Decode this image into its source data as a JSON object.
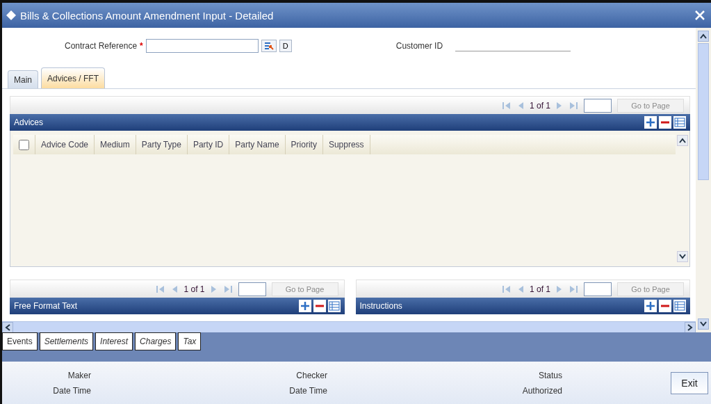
{
  "window": {
    "title": "Bills & Collections Amount Amendment Input - Detailed"
  },
  "header": {
    "contract_reference_label": "Contract Reference",
    "required_mark": "*",
    "default_button": "D",
    "customer_id_label": "Customer ID"
  },
  "tabs": [
    {
      "label": "Main",
      "selected": false
    },
    {
      "label": "Advices / FFT",
      "selected": true
    }
  ],
  "advices": {
    "title": "Advices",
    "pager": {
      "page_text": "1 of 1",
      "go_button": "Go to Page",
      "go_disabled": true
    },
    "select_all_checked": false,
    "columns": [
      "Advice Code",
      "Medium",
      "Party Type",
      "Party ID",
      "Party Name",
      "Priority",
      "Suppress"
    ]
  },
  "sub_panels": [
    {
      "title": "Free Format Text",
      "pager": {
        "page_text": "1 of 1",
        "go_button": "Go to Page",
        "go_disabled": true
      }
    },
    {
      "title": "Instructions",
      "pager": {
        "page_text": "1 of 1",
        "go_button": "Go to Page",
        "go_disabled": true
      }
    }
  ],
  "bottom_tabs": [
    {
      "label": "Events",
      "kind": "normal"
    },
    {
      "label": "Settlements",
      "kind": "italic"
    },
    {
      "label": "Interest",
      "kind": "italic"
    },
    {
      "label": "Charges",
      "kind": "italic"
    },
    {
      "label": "Tax",
      "kind": "italic"
    }
  ],
  "footer": {
    "maker_label": "Maker",
    "maker_date_label": "Date Time",
    "checker_label": "Checker",
    "checker_date_label": "Date Time",
    "status_label": "Status",
    "status_value": "Authorized",
    "exit_button": "Exit"
  }
}
